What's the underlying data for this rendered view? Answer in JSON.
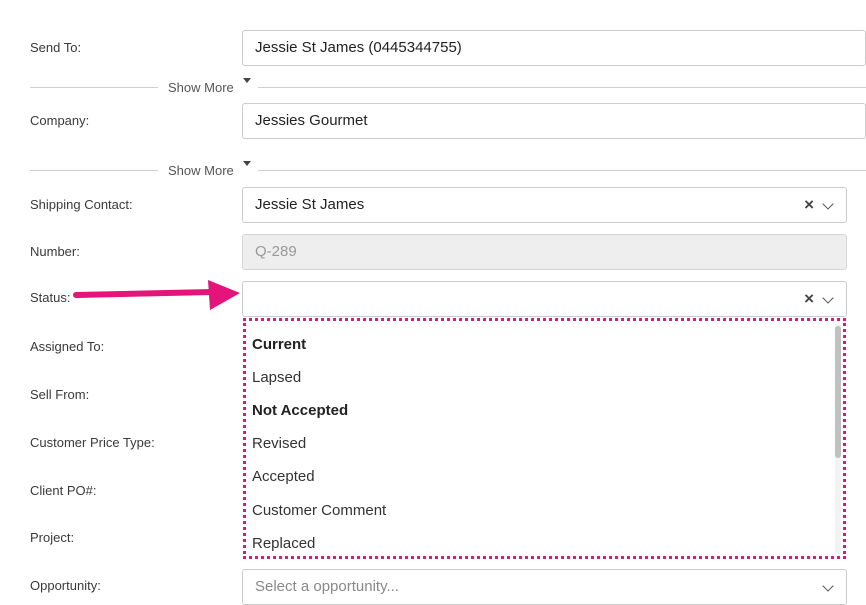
{
  "form": {
    "send_to": {
      "label": "Send To:",
      "value": "Jessie St James (0445344755)"
    },
    "show_more_label": "Show More",
    "company": {
      "label": "Company:",
      "value": "Jessies Gourmet"
    },
    "shipping_contact": {
      "label": "Shipping Contact:",
      "value": "Jessie St James",
      "clear_icon": "×"
    },
    "number": {
      "label": "Number:",
      "value": "Q-289"
    },
    "status": {
      "label": "Status:",
      "value": "",
      "clear_icon": "×"
    },
    "assigned_to": {
      "label": "Assigned To:"
    },
    "sell_from": {
      "label": "Sell From:"
    },
    "customer_price_type": {
      "label": "Customer Price Type:"
    },
    "client_po": {
      "label": "Client PO#:"
    },
    "project": {
      "label": "Project:"
    },
    "opportunity": {
      "label": "Opportunity:",
      "placeholder": "Select a opportunity..."
    }
  },
  "status_dropdown": {
    "options": [
      {
        "label": "Current",
        "bold": true
      },
      {
        "label": "Lapsed",
        "bold": false
      },
      {
        "label": "Not Accepted",
        "bold": true
      },
      {
        "label": "Revised",
        "bold": false
      },
      {
        "label": "Accepted",
        "bold": false
      },
      {
        "label": "Customer Comment",
        "bold": false
      },
      {
        "label": "Replaced",
        "bold": false
      }
    ]
  },
  "colors": {
    "annotation_arrow": "#e4147a",
    "annotation_border": "#d81b77"
  },
  "icons": {
    "clear": "close-icon",
    "dropdown": "chevron-down-icon",
    "show_more": "caret-down-icon",
    "annotation": "arrow-right-icon"
  }
}
